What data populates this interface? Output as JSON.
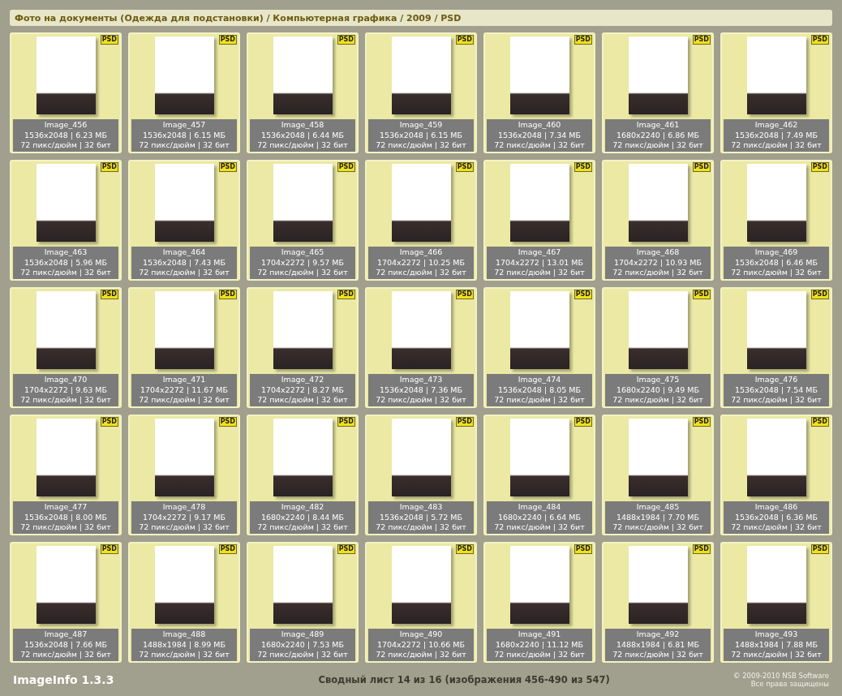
{
  "header": {
    "breadcrumb": "Фото на документы (Одежда для подстановки) / Компьютерная графика / 2009 / PSD"
  },
  "items": [
    {
      "name": "Image_456",
      "size": "1536x2048 | 6.23 МБ",
      "resolution": "72 пикс/дюйм | 32 бит",
      "badge": "PSD"
    },
    {
      "name": "Image_457",
      "size": "1536x2048 | 6.15 МБ",
      "resolution": "72 пикс/дюйм | 32 бит",
      "badge": "PSD"
    },
    {
      "name": "Image_458",
      "size": "1536x2048 | 6.44 МБ",
      "resolution": "72 пикс/дюйм | 32 бит",
      "badge": "PSD"
    },
    {
      "name": "Image_459",
      "size": "1536x2048 | 6.15 МБ",
      "resolution": "72 пикс/дюйм | 32 бит",
      "badge": "PSD"
    },
    {
      "name": "Image_460",
      "size": "1536x2048 | 7.34 МБ",
      "resolution": "72 пикс/дюйм | 32 бит",
      "badge": "PSD"
    },
    {
      "name": "Image_461",
      "size": "1680x2240 | 6.86 МБ",
      "resolution": "72 пикс/дюйм | 32 бит",
      "badge": "PSD"
    },
    {
      "name": "Image_462",
      "size": "1536x2048 | 7.49 МБ",
      "resolution": "72 пикс/дюйм | 32 бит",
      "badge": "PSD"
    },
    {
      "name": "Image_463",
      "size": "1536x2048 | 5.96 МБ",
      "resolution": "72 пикс/дюйм | 32 бит",
      "badge": "PSD"
    },
    {
      "name": "Image_464",
      "size": "1536x2048 | 7.43 МБ",
      "resolution": "72 пикс/дюйм | 32 бит",
      "badge": "PSD"
    },
    {
      "name": "Image_465",
      "size": "1704x2272 | 9.57 МБ",
      "resolution": "72 пикс/дюйм | 32 бит",
      "badge": "PSD"
    },
    {
      "name": "Image_466",
      "size": "1704x2272 | 10.25 МБ",
      "resolution": "72 пикс/дюйм | 32 бит",
      "badge": "PSD"
    },
    {
      "name": "Image_467",
      "size": "1704x2272 | 13.01 МБ",
      "resolution": "72 пикс/дюйм | 32 бит",
      "badge": "PSD"
    },
    {
      "name": "Image_468",
      "size": "1704x2272 | 10.93 МБ",
      "resolution": "72 пикс/дюйм | 32 бит",
      "badge": "PSD"
    },
    {
      "name": "Image_469",
      "size": "1536x2048 | 6.46 МБ",
      "resolution": "72 пикс/дюйм | 32 бит",
      "badge": "PSD"
    },
    {
      "name": "Image_470",
      "size": "1704x2272 | 9.63 МБ",
      "resolution": "72 пикс/дюйм | 32 бит",
      "badge": "PSD"
    },
    {
      "name": "Image_471",
      "size": "1704x2272 | 11.67 МБ",
      "resolution": "72 пикс/дюйм | 32 бит",
      "badge": "PSD"
    },
    {
      "name": "Image_472",
      "size": "1704x2272 | 8.27 МБ",
      "resolution": "72 пикс/дюйм | 32 бит",
      "badge": "PSD"
    },
    {
      "name": "Image_473",
      "size": "1536x2048 | 7.36 МБ",
      "resolution": "72 пикс/дюйм | 32 бит",
      "badge": "PSD"
    },
    {
      "name": "Image_474",
      "size": "1536x2048 | 8.05 МБ",
      "resolution": "72 пикс/дюйм | 32 бит",
      "badge": "PSD"
    },
    {
      "name": "Image_475",
      "size": "1680x2240 | 9.49 МБ",
      "resolution": "72 пикс/дюйм | 32 бит",
      "badge": "PSD"
    },
    {
      "name": "Image_476",
      "size": "1536x2048 | 7.54 МБ",
      "resolution": "72 пикс/дюйм | 32 бит",
      "badge": "PSD"
    },
    {
      "name": "Image_477",
      "size": "1536x2048 | 8.00 МБ",
      "resolution": "72 пикс/дюйм | 32 бит",
      "badge": "PSD"
    },
    {
      "name": "Image_478",
      "size": "1704x2272 | 9.17 МБ",
      "resolution": "72 пикс/дюйм | 32 бит",
      "badge": "PSD"
    },
    {
      "name": "Image_482",
      "size": "1680x2240 | 8.44 МБ",
      "resolution": "72 пикс/дюйм | 32 бит",
      "badge": "PSD"
    },
    {
      "name": "Image_483",
      "size": "1536x2048 | 5.72 МБ",
      "resolution": "72 пикс/дюйм | 32 бит",
      "badge": "PSD"
    },
    {
      "name": "Image_484",
      "size": "1680x2240 | 6.64 МБ",
      "resolution": "72 пикс/дюйм | 32 бит",
      "badge": "PSD"
    },
    {
      "name": "Image_485",
      "size": "1488x1984 | 7.70 МБ",
      "resolution": "72 пикс/дюйм | 32 бит",
      "badge": "PSD"
    },
    {
      "name": "Image_486",
      "size": "1536x2048 | 6.36 МБ",
      "resolution": "72 пикс/дюйм | 32 бит",
      "badge": "PSD"
    },
    {
      "name": "Image_487",
      "size": "1536x2048 | 7.66 МБ",
      "resolution": "72 пикс/дюйм | 32 бит",
      "badge": "PSD"
    },
    {
      "name": "Image_488",
      "size": "1488x1984 | 8.99 МБ",
      "resolution": "72 пикс/дюйм | 32 бит",
      "badge": "PSD"
    },
    {
      "name": "Image_489",
      "size": "1680x2240 | 7.53 МБ",
      "resolution": "72 пикс/дюйм | 32 бит",
      "badge": "PSD"
    },
    {
      "name": "Image_490",
      "size": "1704x2272 | 10.66 МБ",
      "resolution": "72 пикс/дюйм | 32 бит",
      "badge": "PSD"
    },
    {
      "name": "Image_491",
      "size": "1680x2240 | 11.12 МБ",
      "resolution": "72 пикс/дюйм | 32 бит",
      "badge": "PSD"
    },
    {
      "name": "Image_492",
      "size": "1488x1984 | 6.81 МБ",
      "resolution": "72 пикс/дюйм | 32 бит",
      "badge": "PSD"
    },
    {
      "name": "Image_493",
      "size": "1488x1984 | 7.88 МБ",
      "resolution": "72 пикс/дюйм | 32 бит",
      "badge": "PSD"
    }
  ],
  "footer": {
    "app_name": "ImageInfo 1.3.3",
    "page_info": "Сводный лист 14 из 16 (изображения 456-490 из 547)",
    "copyright": [
      "© 2009-2010 NSB Software",
      "Все права защищены"
    ]
  }
}
